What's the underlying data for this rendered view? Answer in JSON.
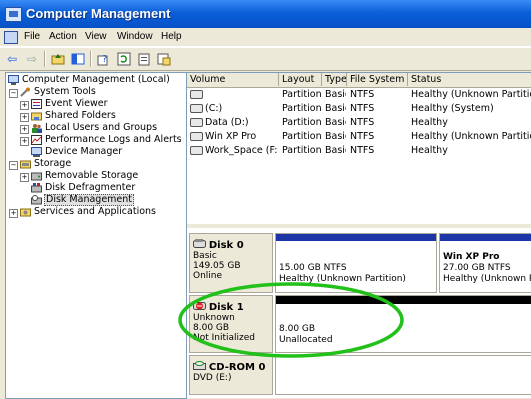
{
  "window": {
    "title": "Computer Management"
  },
  "menu": {
    "items": [
      "File",
      "Action",
      "View",
      "Window",
      "Help"
    ]
  },
  "toolbar": {
    "icons": [
      "back-icon",
      "forward-icon",
      "up-icon",
      "show-hide-tree-icon",
      "help-icon",
      "refresh-icon",
      "properties-icon",
      "export-icon"
    ]
  },
  "tree": {
    "root": "Computer Management (Local)",
    "system_tools": "System Tools",
    "event_viewer": "Event Viewer",
    "shared_folders": "Shared Folders",
    "local_users": "Local Users and Groups",
    "perf_logs": "Performance Logs and Alerts",
    "device_manager": "Device Manager",
    "storage": "Storage",
    "removable": "Removable Storage",
    "defrag": "Disk Defragmenter",
    "disk_mgmt": "Disk Management",
    "services": "Services and Applications"
  },
  "volumes": {
    "headers": [
      "Volume",
      "Layout",
      "Type",
      "File System",
      "Status"
    ],
    "rows": [
      {
        "volume": "",
        "layout": "Partition",
        "type": "Basic",
        "fs": "NTFS",
        "status": "Healthy (Unknown Partition)"
      },
      {
        "volume": "(C:)",
        "layout": "Partition",
        "type": "Basic",
        "fs": "NTFS",
        "status": "Healthy (System)"
      },
      {
        "volume": "Data (D:)",
        "layout": "Partition",
        "type": "Basic",
        "fs": "NTFS",
        "status": "Healthy"
      },
      {
        "volume": "Win XP Pro",
        "layout": "Partition",
        "type": "Basic",
        "fs": "NTFS",
        "status": "Healthy (Unknown Partition)"
      },
      {
        "volume": "Work_Space (F:)",
        "layout": "Partition",
        "type": "Basic",
        "fs": "NTFS",
        "status": "Healthy"
      }
    ]
  },
  "disks": {
    "disk0": {
      "name": "Disk 0",
      "type": "Basic",
      "size": "149.05 GB",
      "status": "Online",
      "part1_line1": "15.00 GB NTFS",
      "part1_line2": "Healthy (Unknown Partition)",
      "part2_name": "Win XP Pro",
      "part2_line1": "27.00 GB NTFS",
      "part2_line2": "Healthy (Unknown Pa"
    },
    "disk1": {
      "name": "Disk 1",
      "type": "Unknown",
      "size": "8.00 GB",
      "status": "Not Initialized",
      "part_line1": "8.00 GB",
      "part_line2": "Unallocated"
    },
    "cdrom0": {
      "name": "CD-ROM 0",
      "drive": "DVD (E:)"
    }
  },
  "colors": {
    "title_bar": "#0a5fd8",
    "primary_partition": "#1c36a8",
    "unallocated": "#000000",
    "highlight_ellipse": "#22c01a"
  }
}
